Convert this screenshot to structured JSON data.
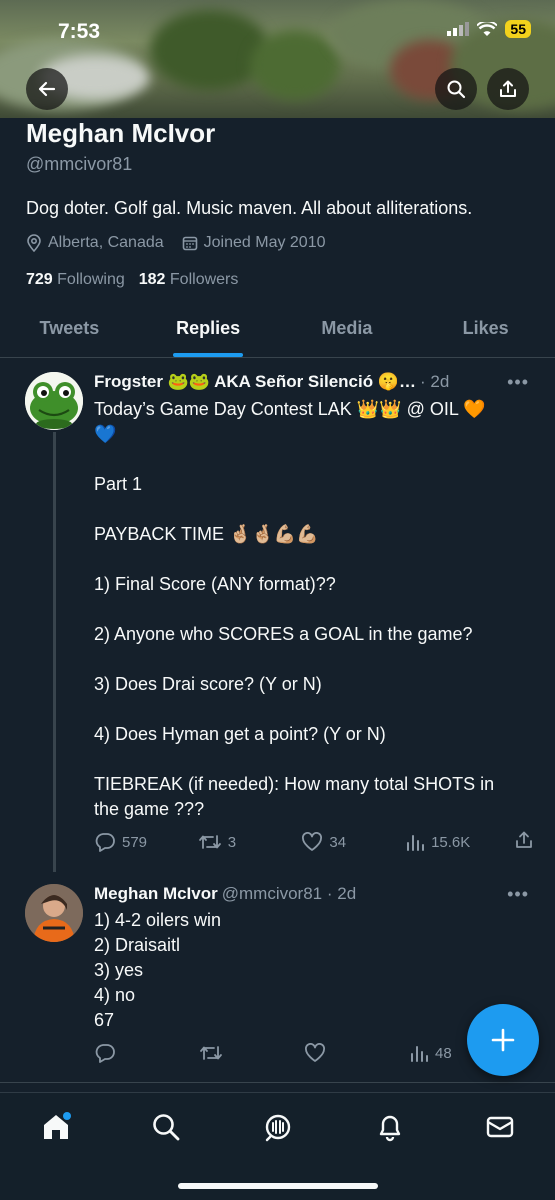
{
  "status": {
    "time": "7:53",
    "battery": "55"
  },
  "profile": {
    "name": "Meghan McIvor",
    "handle": "@mmcivor81",
    "bio": "Dog doter. Golf gal. Music maven. All about alliterations.",
    "location": "Alberta, Canada",
    "joined": "Joined May 2010",
    "following_count": "729",
    "following_label": "Following",
    "followers_count": "182",
    "followers_label": "Followers"
  },
  "tabs": [
    {
      "label": "Tweets",
      "active": false
    },
    {
      "label": "Replies",
      "active": true
    },
    {
      "label": "Media",
      "active": false
    },
    {
      "label": "Likes",
      "active": false
    }
  ],
  "tweets": [
    {
      "display_name": "Frogster 🐸🐸 AKA Señor Silenció 🤫…",
      "meta": "· 2d",
      "lines": [
        "Today’s Game Day Contest LAK 👑👑 @ OIL 🧡",
        "💙",
        "",
        "Part 1",
        "",
        "PAYBACK TIME 🤞🏼🤞🏼💪🏼💪🏼",
        "",
        "1) Final Score (ANY format)??",
        "",
        "2) Anyone who SCORES a GOAL in the game?",
        "",
        "3) Does Drai score? (Y or N)",
        "",
        "4) Does Hyman get a point? (Y or N)",
        "",
        "TIEBREAK (if needed): How many total SHOTS in",
        "the game ???"
      ],
      "replies": "579",
      "retweets": "3",
      "likes": "34",
      "views": "15.6K"
    },
    {
      "display_name": "Meghan McIvor",
      "meta": "@mmcivor81 · 2d",
      "lines": [
        "1) 4-2 oilers win",
        "2) Draisaitl",
        "3) yes",
        "4) no",
        "67"
      ],
      "replies": "",
      "retweets": "",
      "likes": "",
      "views": "48"
    }
  ],
  "colors": {
    "accent": "#1d9bf0",
    "background": "#15202b",
    "muted": "#8b98a5"
  },
  "icons": [
    "back-icon",
    "search-icon",
    "share-icon",
    "location-icon",
    "calendar-icon",
    "reply-icon",
    "retweet-icon",
    "like-icon",
    "views-icon",
    "compose-icon",
    "home-icon",
    "spaces-icon",
    "notifications-icon",
    "messages-icon"
  ]
}
